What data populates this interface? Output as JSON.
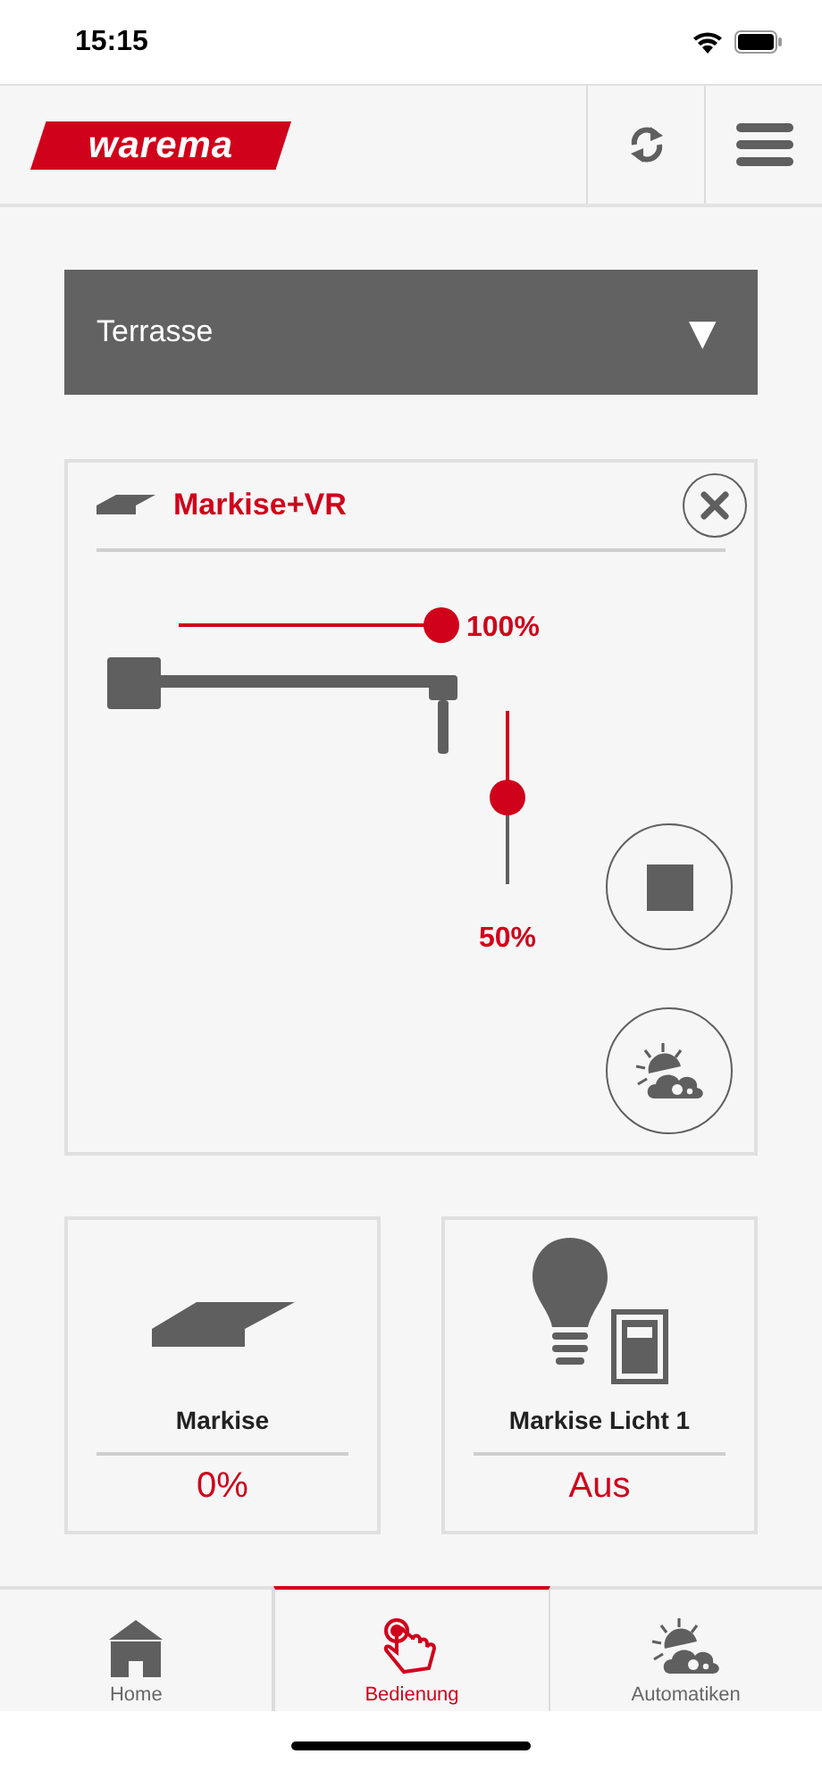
{
  "status_bar": {
    "time": "15:15"
  },
  "header": {
    "logo": "warema"
  },
  "room_select": {
    "value": "Terrasse",
    "arrow": "▼"
  },
  "device_card": {
    "title": "Markise+VR",
    "sliders": [
      {
        "kind": "horizontal",
        "level": 1,
        "reading": "100%"
      },
      {
        "kind": "vertical",
        "level": 0.5,
        "reading": "50%"
      }
    ]
  },
  "tiles": [
    {
      "kind": "awning",
      "name": "Markise",
      "value": "0%"
    },
    {
      "kind": "light",
      "name": "Markise Licht 1",
      "value": "Aus"
    }
  ],
  "tabs": [
    {
      "kind": "home",
      "label": "Home",
      "selected": false
    },
    {
      "kind": "control",
      "label": "Bedienung",
      "selected": true
    },
    {
      "kind": "automatic",
      "label": "Automatiken",
      "selected": false
    }
  ]
}
